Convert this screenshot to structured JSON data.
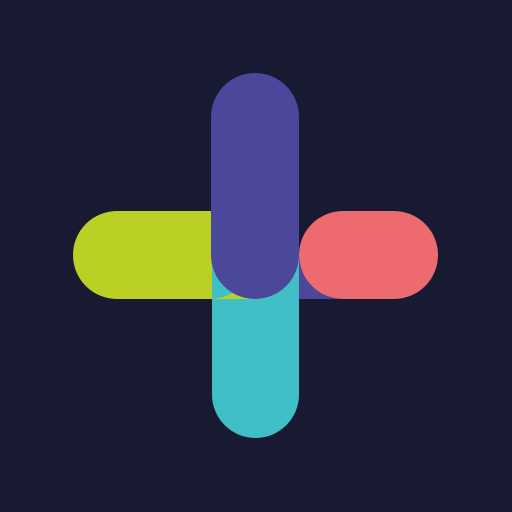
{
  "icon": {
    "name": "plus-logo",
    "background_color": "#181a31",
    "colors": {
      "top": "#4b489b",
      "right": "#ed6b6e",
      "bottom": "#41bfc6",
      "left": "#bbd025"
    }
  }
}
